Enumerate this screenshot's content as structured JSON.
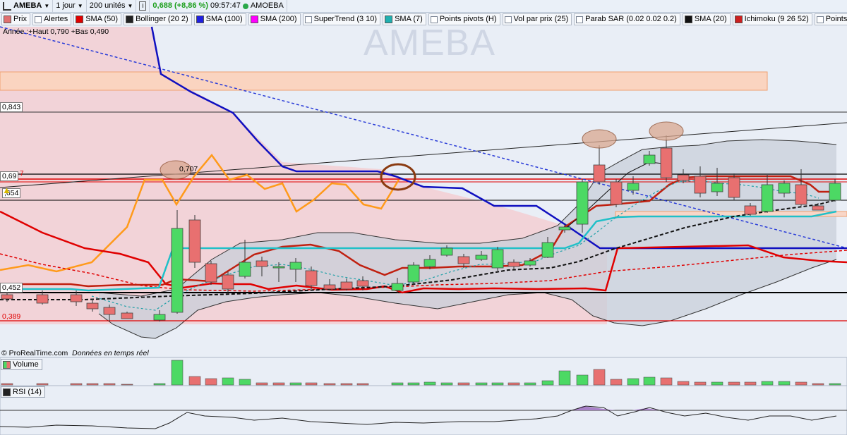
{
  "toolbar": {
    "ticker": "AMEBA",
    "period": "1 jour",
    "units": "200 unités",
    "info": "i",
    "price_change": "0,688 (+8,86 %)",
    "time": "09:57:47",
    "name": "AMOEBA"
  },
  "legend": [
    {
      "label": "Prix",
      "color": "#e07070"
    },
    {
      "label": "Alertes",
      "color": ""
    },
    {
      "label": "SMA (50)",
      "color": "#e00000"
    },
    {
      "label": "Bollinger (20 2)",
      "color": "#222222"
    },
    {
      "label": "SMA (100)",
      "color": "#2020e0"
    },
    {
      "label": "SMA (200)",
      "color": "#ff00ff"
    },
    {
      "label": "SuperTrend (3 10)",
      "color": ""
    },
    {
      "label": "SMA (7)",
      "color": "#20b0b0"
    },
    {
      "label": "Points pivots (H)",
      "color": ""
    },
    {
      "label": "Vol par prix (25)",
      "color": ""
    },
    {
      "label": "Parab SAR (0.02 0.02 0.2)",
      "color": ""
    },
    {
      "label": "SMA (20)",
      "color": "#111111"
    },
    {
      "label": "Ichimoku (9 26 52)",
      "color": "#cc2020"
    },
    {
      "label": "Points pivots (J)",
      "color": ""
    }
  ],
  "year_info": "Année :+Haut 0,790 +Bas 0,490",
  "watermark": "AMEBA",
  "price_labels": {
    "p843": "0,843",
    "p69": "0,69",
    "p654": ",654",
    "p452": "0,452",
    "p389": "0,389",
    "p7": "7"
  },
  "annotation_707": "0,707",
  "source": "© ProRealTime.com",
  "realtime": "Données en temps réel",
  "volume_label": "Volume",
  "rsi_label": "RSI (14)",
  "colors": {
    "up": "#4cd964",
    "down": "#e87070",
    "sma7": "#20c0c8",
    "sma100": "#1010c0",
    "sma50": "#e00000",
    "orange": "#ff9a1a",
    "ichimoku": "#c02010"
  }
}
